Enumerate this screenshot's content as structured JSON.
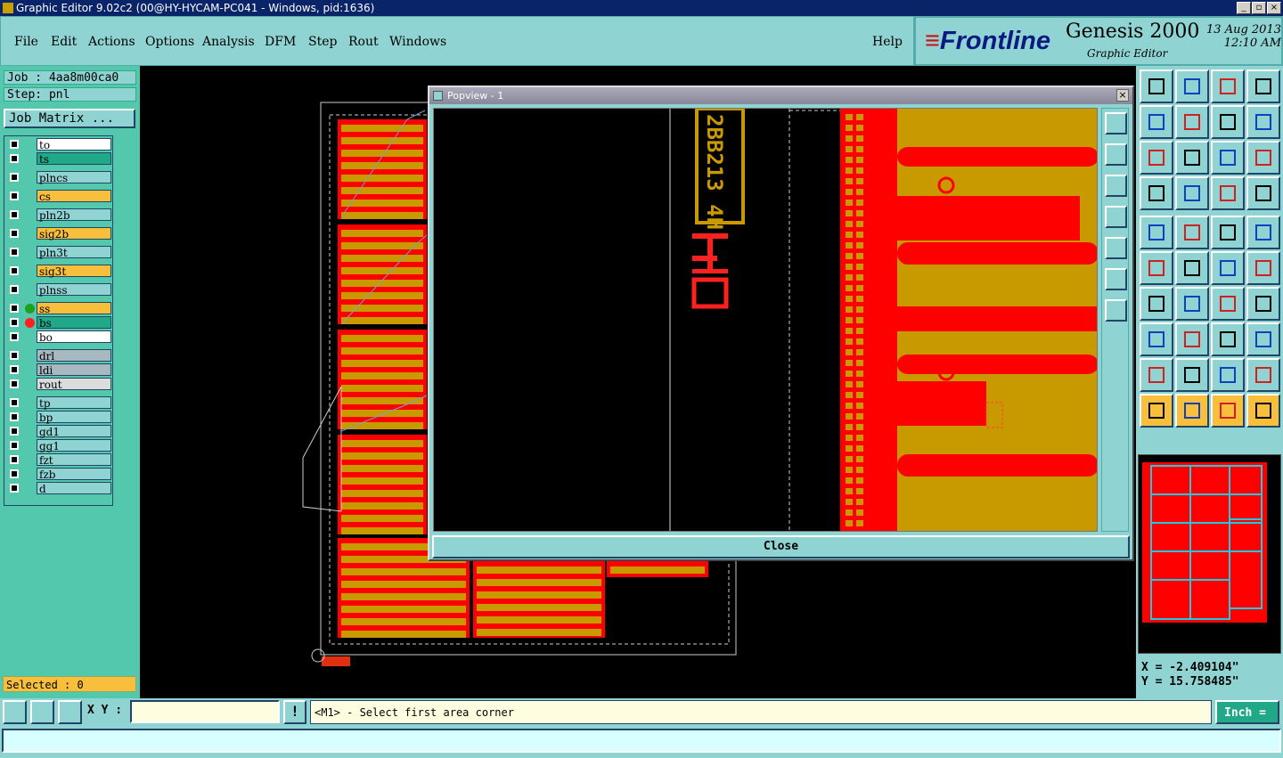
{
  "window": {
    "title": "Graphic Editor 9.02c2 (00@HY-HYCAM-PC041 - Windows, pid:1636)"
  },
  "menu": [
    {
      "label": "File"
    },
    {
      "label": "Edit"
    },
    {
      "label": "Actions"
    },
    {
      "label": "Options"
    },
    {
      "label": "Analysis"
    },
    {
      "label": "DFM"
    },
    {
      "label": "Step"
    },
    {
      "label": "Rout"
    },
    {
      "label": "Windows"
    },
    {
      "label": "Help"
    }
  ],
  "brand": {
    "company": "Frontline",
    "product": "Genesis 2000",
    "module": "Graphic Editor",
    "date": "13 Aug 2013",
    "time": "12:10 AM"
  },
  "job": {
    "job_label": "Job : 4aa8m00ca0",
    "step_label": "Step: pnl",
    "matrix_button": "Job Matrix ..."
  },
  "layers": [
    {
      "name": "to",
      "color": "#ffffff"
    },
    {
      "name": "ts",
      "color": "#20a888"
    },
    {
      "name": "plncs",
      "color": "#8fd3d3"
    },
    {
      "name": "cs",
      "color": "#f7bf3c"
    },
    {
      "name": "pln2b",
      "color": "#8fd3d3"
    },
    {
      "name": "sig2b",
      "color": "#f7bf3c"
    },
    {
      "name": "pln3t",
      "color": "#8fd3d3"
    },
    {
      "name": "sig3t",
      "color": "#f7bf3c"
    },
    {
      "name": "plnss",
      "color": "#8fd3d3"
    },
    {
      "name": "ss",
      "color": "#f7bf3c"
    },
    {
      "name": "bs",
      "color": "#20a888"
    },
    {
      "name": "bo",
      "color": "#ffffff"
    },
    {
      "name": "drl",
      "color": "#a8b8c0"
    },
    {
      "name": "ldi",
      "color": "#a8b8c0"
    },
    {
      "name": "rout",
      "color": "#dcdcdc"
    },
    {
      "name": "tp",
      "color": "#8fd3d3"
    },
    {
      "name": "bp",
      "color": "#8fd3d3"
    },
    {
      "name": "gd1",
      "color": "#8fd3d3"
    },
    {
      "name": "gg1",
      "color": "#8fd3d3"
    },
    {
      "name": "fzt",
      "color": "#8fd3d3"
    },
    {
      "name": "fzb",
      "color": "#8fd3d3"
    },
    {
      "name": "d",
      "color": "#8fd3d3"
    }
  ],
  "selection": {
    "label": "Selected : 0"
  },
  "popview": {
    "title": "Popview - 1",
    "close_label": "Close",
    "board_text": "2BB213 4H"
  },
  "coords": {
    "x": "X = -2.409104\"",
    "y": "Y = 15.758485\""
  },
  "bottom": {
    "xy_label": "X Y :",
    "xy_value": "",
    "bang": "!",
    "prompt": "<M1> - Select first area corner",
    "unit": "Inch ="
  },
  "colors": {
    "copper": "#c89a00",
    "mask": "#ff0000",
    "panel": "#8fd3d3",
    "accent": "#54c8ac"
  }
}
